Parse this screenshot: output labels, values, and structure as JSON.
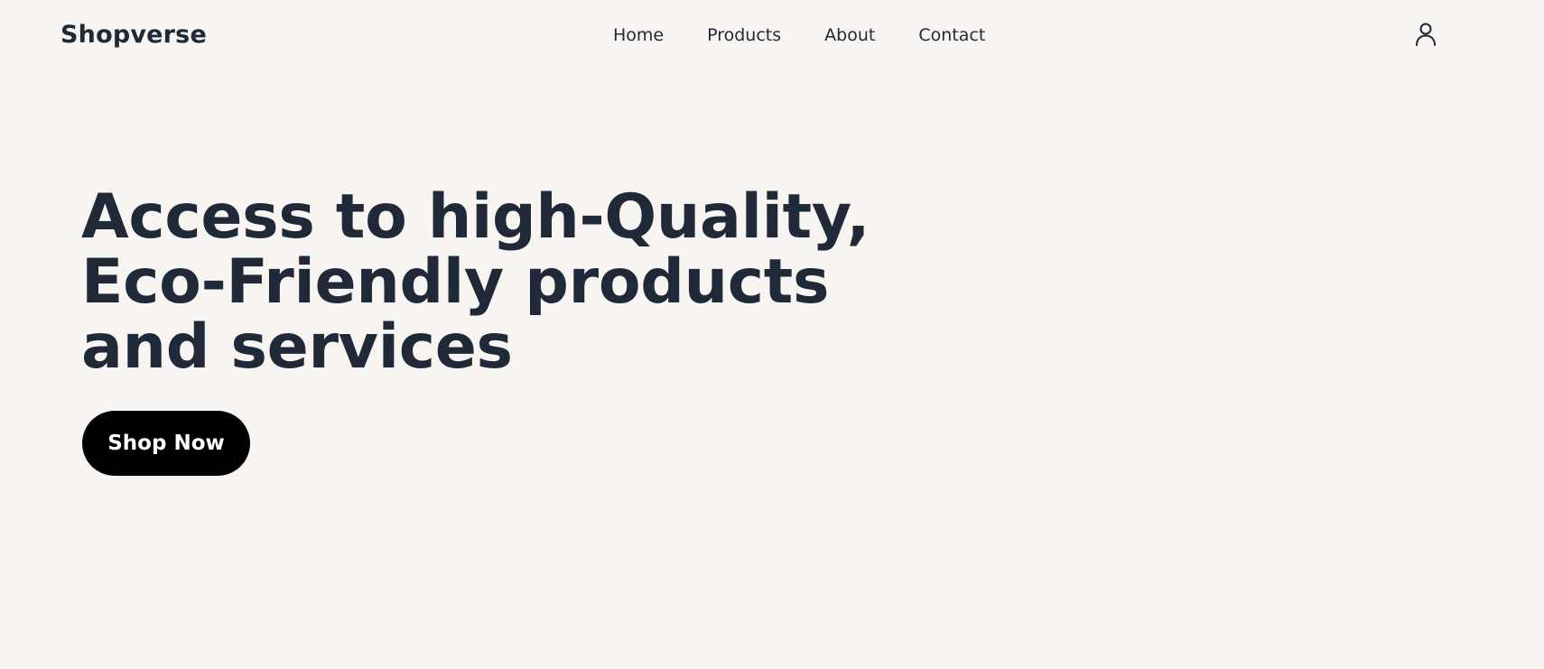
{
  "brand": {
    "name": "Shopverse"
  },
  "nav": {
    "links": [
      {
        "label": "Home"
      },
      {
        "label": "Products"
      },
      {
        "label": "About"
      },
      {
        "label": "Contact"
      }
    ],
    "profile_icon": "user-icon"
  },
  "hero": {
    "title_lines": [
      "Access to high-Quality,",
      "Eco-Friendly products",
      "and services"
    ],
    "cta_label": "Shop Now"
  },
  "colors": {
    "background": "#f8f4f1",
    "text": "#1f2937",
    "button_bg": "#000000",
    "button_text": "#ffffff"
  }
}
